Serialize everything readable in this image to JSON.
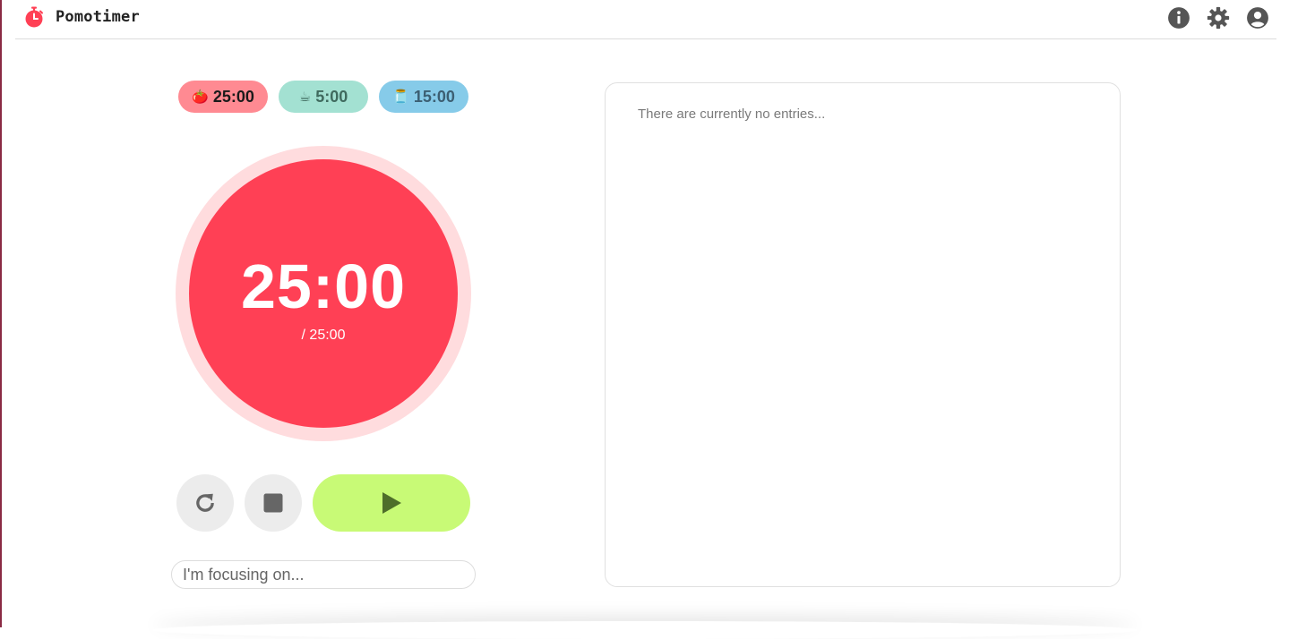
{
  "app": {
    "title": "Pomotimer",
    "accent_color": "#ff4055"
  },
  "header": {
    "actions": [
      {
        "icon": "info-icon"
      },
      {
        "icon": "gear-icon"
      },
      {
        "icon": "account-icon"
      }
    ]
  },
  "presets": [
    {
      "emoji": "🍅",
      "label": "25:00",
      "color": "#ff8a92",
      "selected": true
    },
    {
      "emoji": "☕",
      "label": "5:00",
      "color": "#a3e1d2",
      "selected": false
    },
    {
      "emoji": "🫙",
      "label": "15:00",
      "color": "#86cbe9",
      "selected": false
    }
  ],
  "timer": {
    "remaining": "25:00",
    "total": "/ 25:00",
    "progress": 0
  },
  "controls": {
    "reset_icon": "reset-icon",
    "stop_icon": "stop-icon",
    "play_icon": "play-icon",
    "play_color": "#c8fa76"
  },
  "focus": {
    "placeholder": "I'm focusing on...",
    "value": ""
  },
  "entries": {
    "empty_text": "There are currently no entries..."
  }
}
